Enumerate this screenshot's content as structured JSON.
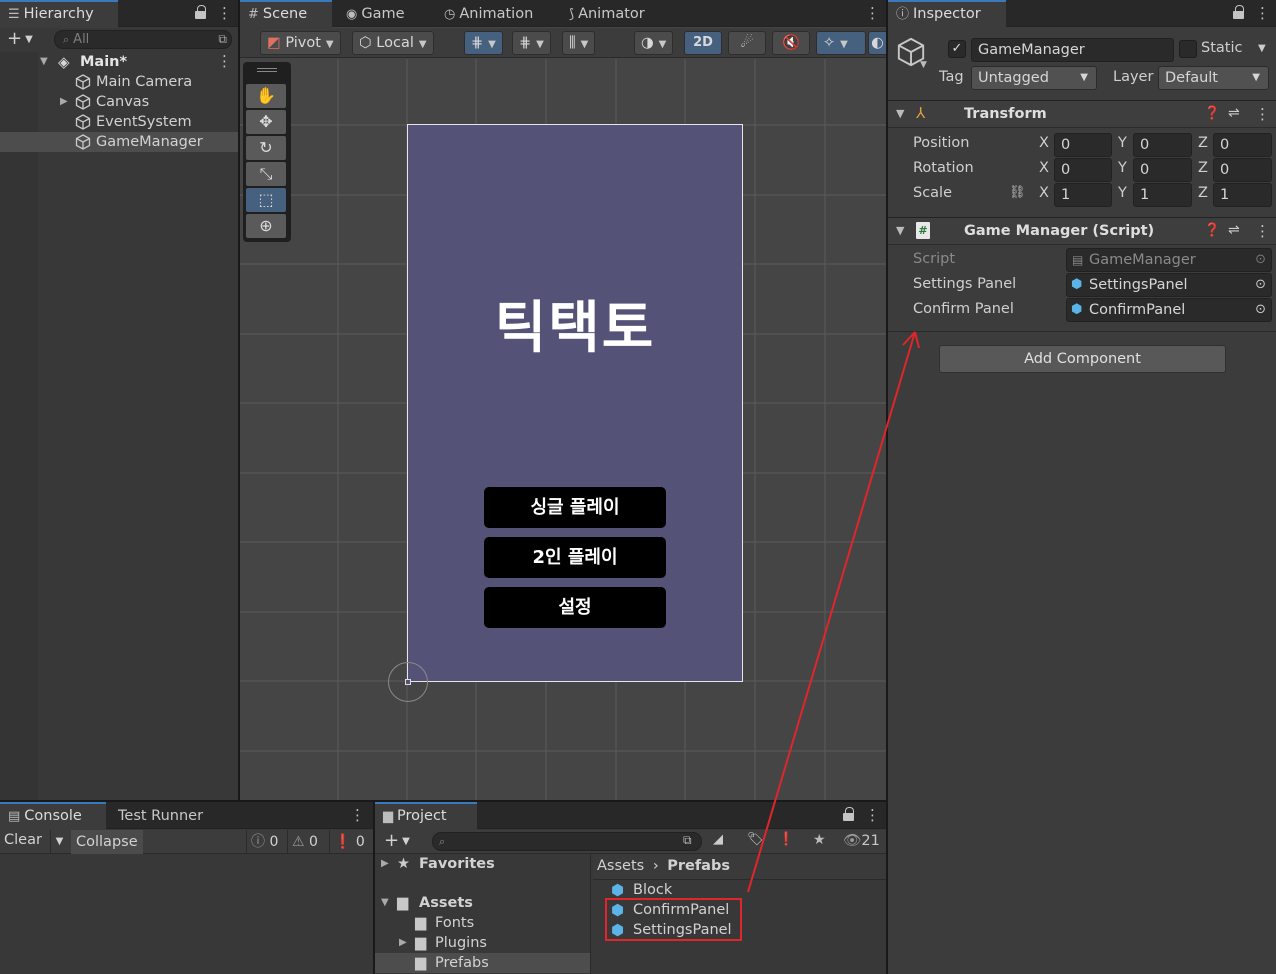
{
  "hierarchy": {
    "tab": "Hierarchy",
    "search_placeholder": "All",
    "scene_name": "Main*",
    "items": [
      {
        "label": "Main Camera"
      },
      {
        "label": "Canvas"
      },
      {
        "label": "EventSystem"
      },
      {
        "label": "GameManager"
      }
    ]
  },
  "scene_view": {
    "tabs": [
      {
        "label": "Scene",
        "icon": "grid-icon"
      },
      {
        "label": "Game",
        "icon": "gamepad-icon"
      },
      {
        "label": "Animation",
        "icon": "clock-icon"
      },
      {
        "label": "Animator",
        "icon": "animator-icon"
      }
    ],
    "toolbar": {
      "pivot": "Pivot",
      "local": "Local",
      "mode_2d": "2D"
    },
    "tools": [
      "hand-tool",
      "move-tool",
      "rotate-tool",
      "scale-tool",
      "rect-tool",
      "transform-tool"
    ],
    "game": {
      "title": "틱택토",
      "buttons": [
        "싱글 플레이",
        "2인 플레이",
        "설정"
      ],
      "canvas_color": "#545277"
    }
  },
  "inspector": {
    "tab": "Inspector",
    "object_name": "GameManager",
    "static_label": "Static",
    "tag_label": "Tag",
    "tag_value": "Untagged",
    "layer_label": "Layer",
    "layer_value": "Default",
    "transform": {
      "title": "Transform",
      "rows": [
        {
          "label": "Position",
          "x": "0",
          "y": "0",
          "z": "0"
        },
        {
          "label": "Rotation",
          "x": "0",
          "y": "0",
          "z": "0"
        },
        {
          "label": "Scale",
          "x": "1",
          "y": "1",
          "z": "1"
        }
      ],
      "axis": [
        "X",
        "Y",
        "Z"
      ]
    },
    "script_component": {
      "title": "Game Manager (Script)",
      "fields": [
        {
          "label": "Script",
          "value": "GameManager"
        },
        {
          "label": "Settings Panel",
          "value": "SettingsPanel"
        },
        {
          "label": "Confirm Panel",
          "value": "ConfirmPanel"
        }
      ]
    },
    "add_component": "Add Component"
  },
  "console": {
    "tabs": [
      "Console",
      "Test Runner"
    ],
    "clear": "Clear",
    "collapse": "Collapse",
    "counts": {
      "info": "0",
      "warning": "0",
      "error": "0"
    }
  },
  "project": {
    "tab": "Project",
    "hidden_count": "21",
    "tree": {
      "favorites": "Favorites",
      "assets": "Assets",
      "children": [
        "Fonts",
        "Plugins",
        "Prefabs"
      ]
    },
    "breadcrumb": [
      "Assets",
      "Prefabs"
    ],
    "files": [
      "Block",
      "ConfirmPanel",
      "SettingsPanel"
    ]
  },
  "annotation_color": "#e0252b"
}
